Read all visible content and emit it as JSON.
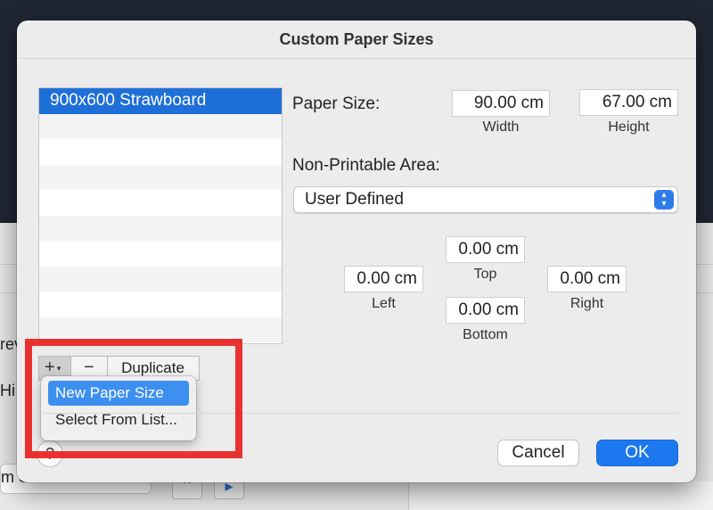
{
  "background": {
    "left_text_1": "rev",
    "left_text_2": "Hi",
    "select_fragment": "m Size..."
  },
  "dialog": {
    "title": "Custom Paper Sizes",
    "list": {
      "items": [
        "900x600 Strawboard"
      ],
      "selected_index": 0
    },
    "list_controls": {
      "add_label": "+",
      "remove_label": "−",
      "duplicate_label": "Duplicate"
    },
    "add_menu": {
      "items": [
        "New Paper Size",
        "Select From List..."
      ],
      "highlighted_index": 0
    },
    "help_label": "?",
    "paper_size": {
      "label": "Paper Size:",
      "width_value": "90.00 cm",
      "width_caption": "Width",
      "height_value": "67.00 cm",
      "height_caption": "Height"
    },
    "non_printable": {
      "label": "Non-Printable Area:",
      "selected": "User Defined"
    },
    "margins": {
      "top_value": "0.00 cm",
      "top_caption": "Top",
      "left_value": "0.00 cm",
      "left_caption": "Left",
      "right_value": "0.00 cm",
      "right_caption": "Right",
      "bottom_value": "0.00 cm",
      "bottom_caption": "Bottom"
    },
    "buttons": {
      "cancel": "Cancel",
      "ok": "OK"
    }
  },
  "colors": {
    "accent": "#1d78f0",
    "selection": "#1f6fd8",
    "highlight_box": "#e8322f"
  }
}
